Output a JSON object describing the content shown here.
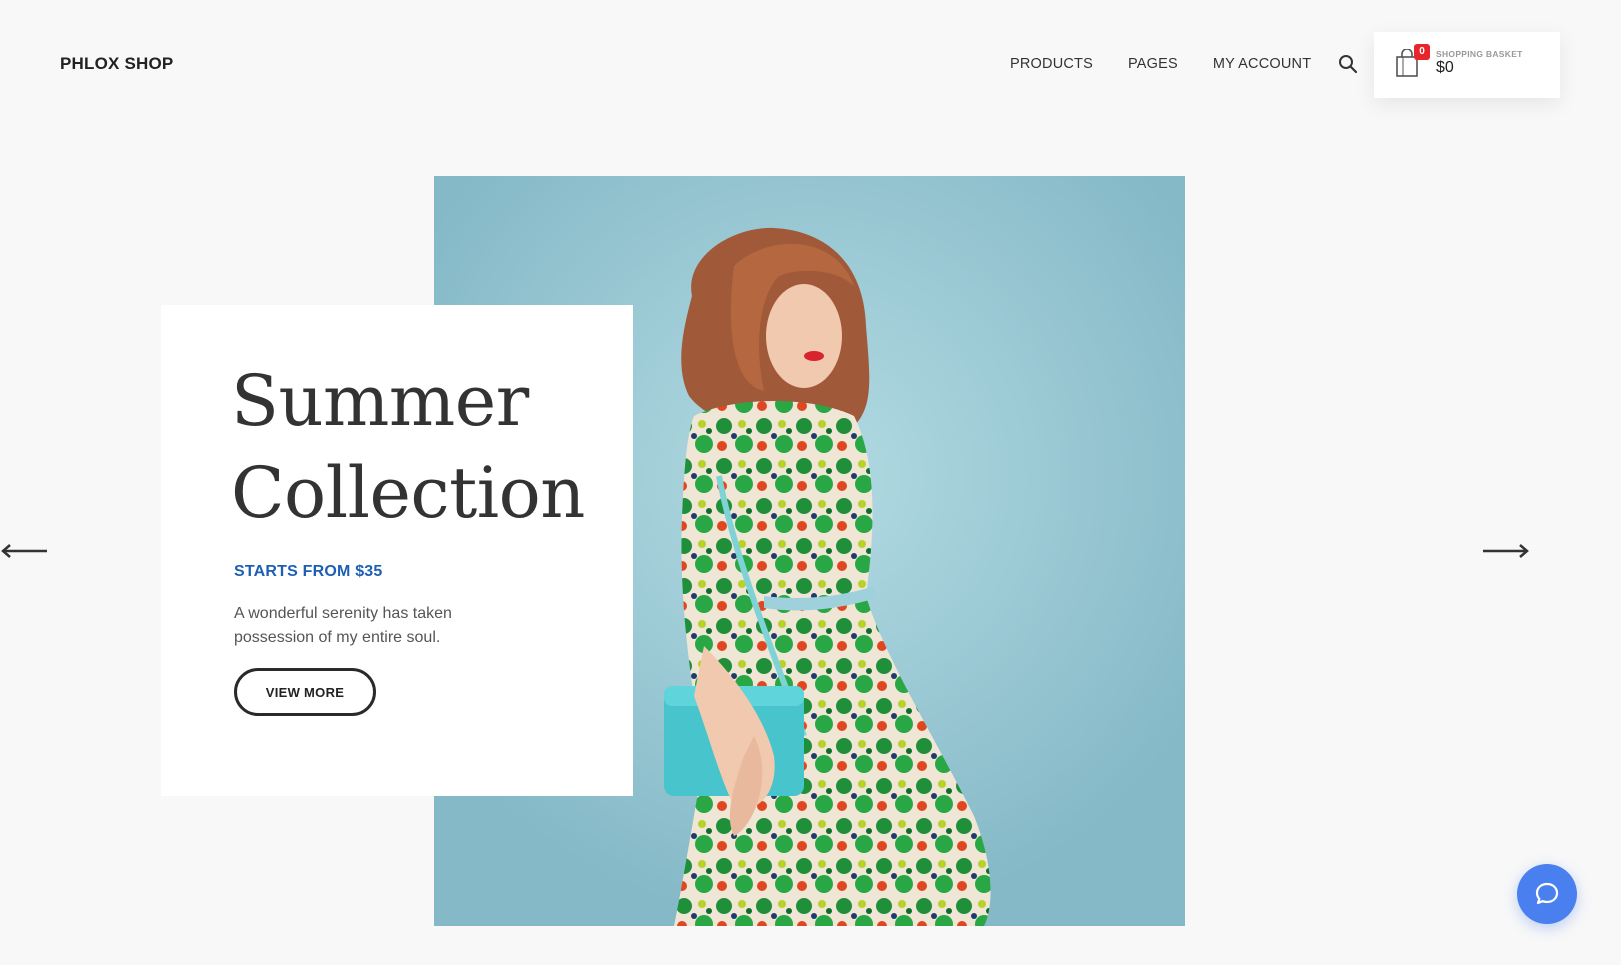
{
  "header": {
    "logo": "PHLOX SHOP",
    "nav": [
      {
        "label": "PRODUCTS"
      },
      {
        "label": "PAGES"
      },
      {
        "label": "MY ACCOUNT"
      }
    ],
    "search_icon": "search-icon",
    "cart": {
      "count": "0",
      "label": "SHOPPING BASKET",
      "total": "$0",
      "icon": "shopping-bag-icon"
    }
  },
  "hero": {
    "title_line1": "Summer",
    "title_line2": "Collection",
    "price_text": "STARTS FROM $35",
    "description": "A wonderful serenity has taken possession of my entire soul.",
    "cta_label": "VIEW MORE",
    "image": "woman-in-floral-dress-photo"
  },
  "slider": {
    "prev_icon": "arrow-left-icon",
    "next_icon": "arrow-right-icon"
  },
  "chat": {
    "icon": "chat-bubble-icon"
  },
  "colors": {
    "accent_blue": "#1d5fb5",
    "chat_blue": "#4a7fef",
    "badge_red": "#e8242c",
    "hero_bg": "#9ccbd6"
  }
}
